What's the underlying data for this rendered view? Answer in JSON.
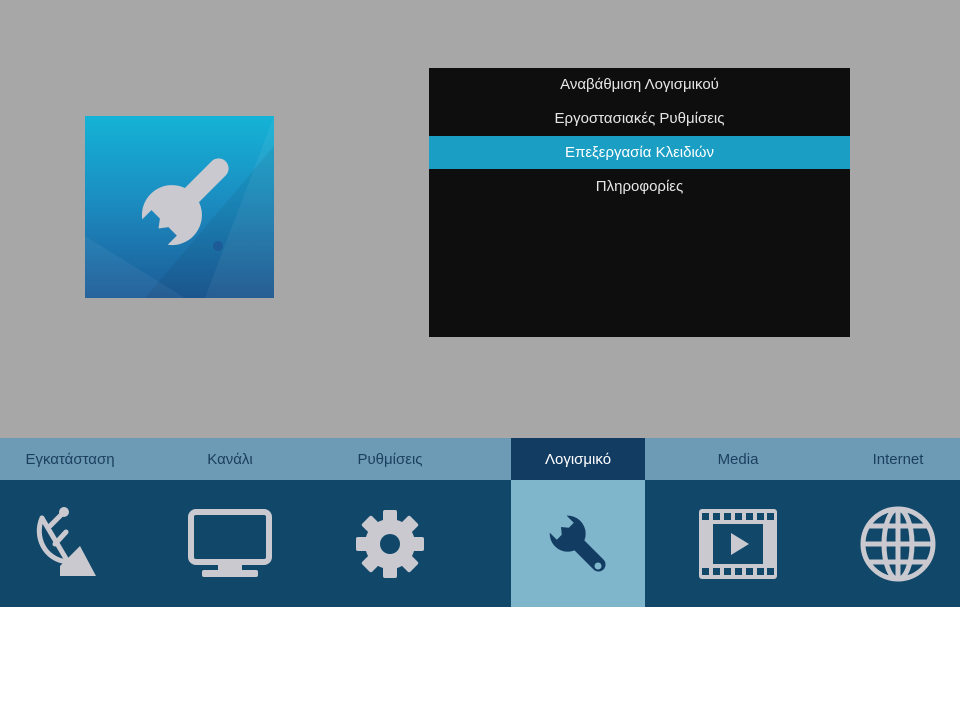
{
  "menu": {
    "items": [
      {
        "label": "Αναβάθμιση Λογισμικού",
        "selected": false
      },
      {
        "label": "Εργοστασιακές Ρυθμίσεις",
        "selected": false
      },
      {
        "label": "Επεξεργασία Κλειδιών",
        "selected": true
      },
      {
        "label": "Πληροφορίες",
        "selected": false
      }
    ]
  },
  "preview": {
    "icon": "wrench-icon"
  },
  "tabs": [
    {
      "label": "Εγκατάσταση",
      "icon": "satellite-dish-icon",
      "active": false
    },
    {
      "label": "Κανάλι",
      "icon": "tv-icon",
      "active": false
    },
    {
      "label": "Ρυθμίσεις",
      "icon": "gear-icon",
      "active": false
    },
    {
      "label": "Λογισμικό",
      "icon": "wrench-icon",
      "active": true
    },
    {
      "label": "Media",
      "icon": "film-icon",
      "active": false
    },
    {
      "label": "Internet",
      "icon": "globe-icon",
      "active": false
    }
  ],
  "colors": {
    "background": "#a7a7a7",
    "menu_bg": "#0e0e0e",
    "highlight": "#1a9ec4",
    "tab_bar": "#6d9ab4",
    "active_tab": "#133c63",
    "icon_bar": "#114769",
    "active_tile": "#7fb6cc",
    "icon_fill": "#c9c9cf"
  }
}
